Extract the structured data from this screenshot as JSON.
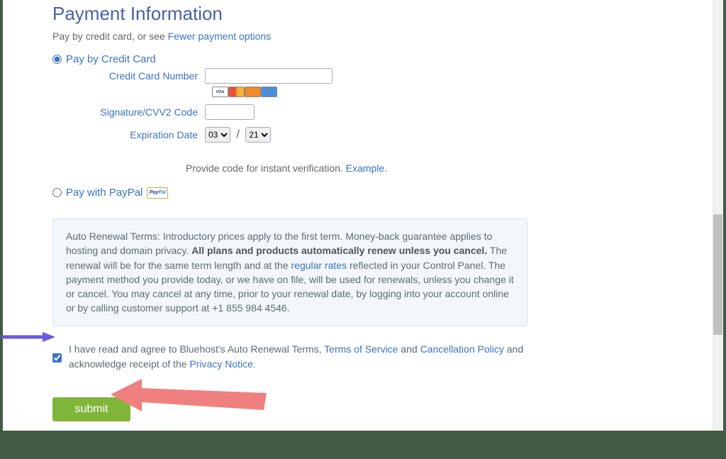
{
  "title": "Payment Information",
  "payby_prefix": "Pay by credit card, or see ",
  "payby_link": "Fewer payment options",
  "cc": {
    "radio_label": "Pay by Credit Card",
    "num_label": "Credit Card Number",
    "cvv_label": "Signature/CVV2 Code",
    "exp_label": "Expiration Date",
    "exp_month": "03",
    "exp_year": "21",
    "cards": {
      "visa": "VISA",
      "mc": "",
      "disc": "",
      "amex": ""
    }
  },
  "verify": {
    "text": "Provide code for instant verification. ",
    "link": "Example",
    "dot": "."
  },
  "paypal": {
    "radio_label": "Pay with PayPal",
    "badge_a": "Pay",
    "badge_b": "Pal"
  },
  "terms": {
    "pre": "Auto Renewal Terms: Introductory prices apply to the first term. Money-back guarantee applies to hosting and domain privacy. ",
    "bold": "All plans and products automatically renew unless you cancel.",
    "mid1": " The renewal will be for the same term length and at the ",
    "rates_link": "regular rates",
    "mid2": " reflected in your Control Panel. The payment method you provide today, or we have on file, will be used for renewals, unless you change it or cancel. You may cancel at any time, prior to your renewal date, by logging into your account online or by calling customer support at +1 855 984 4546."
  },
  "agree": {
    "t1": "I have read and agree to Bluehost's Auto Renewal Terms, ",
    "tos": "Terms of Service",
    "t2": " and ",
    "cancel": "Cancellation Policy",
    "t3": " and acknowledge receipt of the ",
    "privacy": "Privacy Notice",
    "t4": "."
  },
  "submit_label": "submit"
}
